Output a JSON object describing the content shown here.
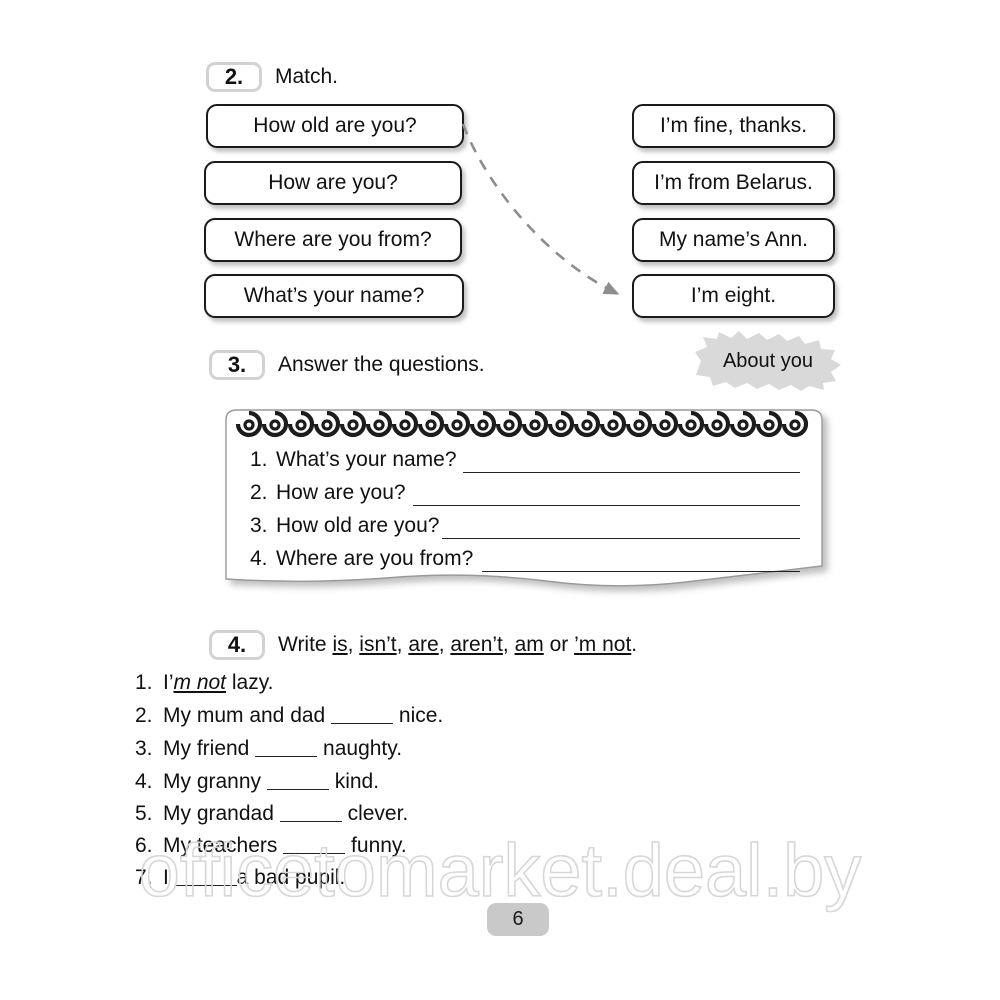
{
  "page": {
    "number": "6",
    "watermark": "officetomarket.deal.by",
    "background_color": "#ffffff"
  },
  "exercise2": {
    "number": "2.",
    "title": "Match.",
    "left_column": [
      {
        "text": "How old are you?"
      },
      {
        "text": "How are you?"
      },
      {
        "text": "Where are you from?"
      },
      {
        "text": "What’s your name?"
      }
    ],
    "right_column": [
      {
        "text": "I’m fine, thanks."
      },
      {
        "text": "I’m from Belarus."
      },
      {
        "text": "My name’s Ann."
      },
      {
        "text": "I’m eight."
      }
    ],
    "connector": {
      "from": "How old are you?",
      "to": "I’m eight.",
      "style": "dashed-curved-arrow",
      "color": "#8d8d8d"
    }
  },
  "exercise3": {
    "number": "3.",
    "title": "Answer the questions.",
    "badge": "About you",
    "badge_color": "#d9d9d9",
    "questions": [
      {
        "num": "1.",
        "text": "What’s your name?"
      },
      {
        "num": "2.",
        "text": "How are you?"
      },
      {
        "num": "3.",
        "text": "How old are you?"
      },
      {
        "num": "4.",
        "text": "Where are you from?"
      }
    ]
  },
  "exercise4": {
    "number": "4.",
    "title_prefix": "Write ",
    "title_words": [
      "is",
      "isn’t",
      "are",
      "aren’t",
      "am"
    ],
    "title_or": " or ",
    "title_last": "’m not",
    "title_end": ".",
    "items": [
      {
        "num": "1.",
        "before": "I’",
        "answer": "m not",
        "after": " lazy.",
        "blank": false
      },
      {
        "num": "2.",
        "before": "My mum and dad ",
        "answer": "",
        "after": " nice.",
        "blank": true
      },
      {
        "num": "3.",
        "before": "My friend ",
        "answer": "",
        "after": " naughty.",
        "blank": true
      },
      {
        "num": "4.",
        "before": "My granny ",
        "answer": "",
        "after": " kind.",
        "blank": true
      },
      {
        "num": "5.",
        "before": "My grandad ",
        "answer": "",
        "after": " clever.",
        "blank": true
      },
      {
        "num": "6.",
        "before": "My teachers ",
        "answer": "",
        "after": " funny.",
        "blank": true
      },
      {
        "num": "7.",
        "before": "I ",
        "answer": "",
        "after": "a bad pupil.",
        "blank": true
      }
    ]
  }
}
